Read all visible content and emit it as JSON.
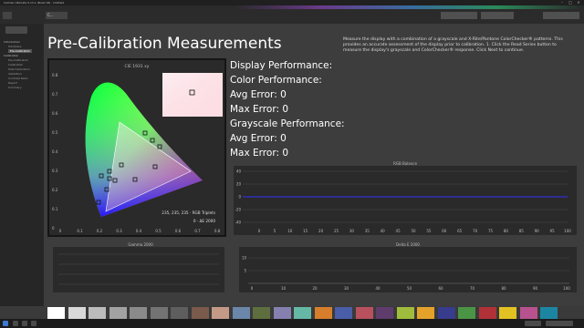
{
  "window": {
    "title": "Calman Ultimate 5.13.1 (Build 18) - Untitled"
  },
  "toolbar": {
    "tab_label": "C...",
    "right_buttons": [
      "",
      "",
      ""
    ]
  },
  "sidebar": {
    "items": [
      {
        "label": "Introduction",
        "sub": false,
        "active": false
      },
      {
        "label": "Hardware",
        "sub": true,
        "active": false
      },
      {
        "label": "Pre-Calibration",
        "sub": true,
        "active": true
      },
      {
        "label": "Calibration",
        "sub": false,
        "active": false
      },
      {
        "label": "Pre-Calibration",
        "sub": true,
        "active": false
      },
      {
        "label": "Calibration",
        "sub": true,
        "active": false
      },
      {
        "label": "Post-Calibration",
        "sub": true,
        "active": false
      },
      {
        "label": "Validation",
        "sub": true,
        "active": false
      },
      {
        "label": "Contrast Ratio",
        "sub": true,
        "active": false
      },
      {
        "label": "Report",
        "sub": true,
        "active": false
      },
      {
        "label": "Summary",
        "sub": true,
        "active": false
      }
    ]
  },
  "page": {
    "title": "Pre-Calibration Measurements",
    "instructions": "Measure the display with a combination of a grayscale and X-Rite/Pantone ColorChecker® patterns. This provides an accurate assessment of the display prior to calibration. 1. Click the Read Series button to measure the display's grayscale and ColorChecker® response. Click Next to continue."
  },
  "stats": {
    "display_performance": "Display Performance:",
    "color_performance": "Color Performance:",
    "color_avg": "Avg Error: 0",
    "color_max": "Max Error: 0",
    "grayscale_performance": "Grayscale Performance:",
    "gray_avg": "Avg Error: 0",
    "gray_max": "Max Error: 0"
  },
  "cie": {
    "title": "CIE 1931 xy",
    "readout_line1": "235, 235, 235 · RGB Triplets",
    "readout_line2": "0 · ΔE 2000",
    "x_ticks": [
      "0",
      "0.1",
      "0.2",
      "0.3",
      "0.4",
      "0.5",
      "0.6",
      "0.7",
      "0.8"
    ],
    "y_ticks": [
      "0.8",
      "0.7",
      "0.6",
      "0.5",
      "0.4",
      "0.3",
      "0.2",
      "0.1",
      "0"
    ]
  },
  "rgb_chart": {
    "title": "RGB Balance",
    "y_ticks": [
      "40",
      "20",
      "0",
      "-20",
      "-40"
    ],
    "x_ticks": [
      "0",
      "5",
      "10",
      "15",
      "20",
      "25",
      "30",
      "35",
      "40",
      "45",
      "50",
      "55",
      "60",
      "65",
      "70",
      "75",
      "80",
      "85",
      "90",
      "95",
      "100"
    ]
  },
  "gamma_chart": {
    "title": "Gamma 2000"
  },
  "delta_chart": {
    "title": "Delta E 2000",
    "y_ticks": [
      "10",
      "5"
    ],
    "x_ticks": [
      "0",
      "10",
      "20",
      "30",
      "40",
      "50",
      "60",
      "70",
      "80",
      "90",
      "100"
    ]
  },
  "swatches": [
    "#ffffff",
    "#d8d8d8",
    "#bcbcbc",
    "#a2a2a2",
    "#8a8a8a",
    "#737373",
    "#5e5e5e",
    "#7a5a4a",
    "#c49a86",
    "#6a86a8",
    "#5e6e3e",
    "#8480b0",
    "#66b8a6",
    "#d67e2c",
    "#4a5ea8",
    "#b8505e",
    "#5e3c6c",
    "#a0bc3c",
    "#e4a22a",
    "#383c8c",
    "#4a9446",
    "#b03238",
    "#e2c222",
    "#b8528e",
    "#1c86a2",
    "#3a3a3a"
  ]
}
